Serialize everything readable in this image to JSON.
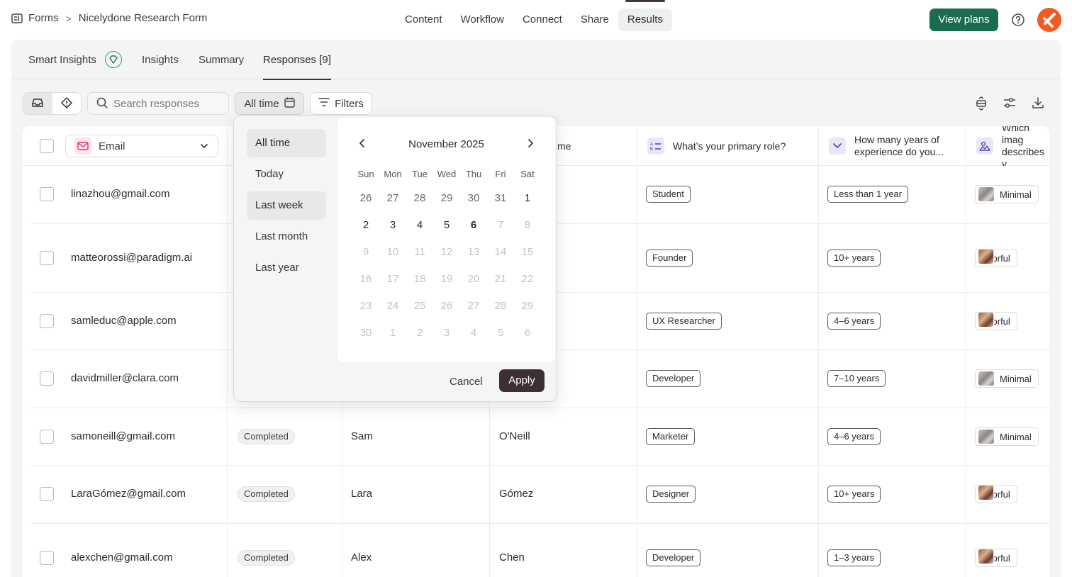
{
  "breadcrumb": {
    "root": "Forms",
    "separator": ">",
    "current": "Nicelydone Research Form"
  },
  "nav": {
    "items": [
      "Content",
      "Workflow",
      "Connect",
      "Share",
      "Results"
    ],
    "active": "Results"
  },
  "header": {
    "cta": "View plans"
  },
  "tabs": [
    {
      "label": "Smart Insights"
    },
    {
      "label": "Insights"
    },
    {
      "label": "Summary"
    },
    {
      "label": "Responses [9]",
      "active": true
    }
  ],
  "toolbar": {
    "search_placeholder": "Search responses",
    "date_button": "All time",
    "filters_button": "Filters"
  },
  "table": {
    "email_column": "Email",
    "headers": {
      "last_name_partial": "me",
      "role": "What’s your primary role?",
      "experience": "How many years of experience do you...",
      "image": "Which imag describes y"
    },
    "rows": [
      {
        "email": "linazhou@gmail.com",
        "status": "",
        "first": "",
        "last": "",
        "role": "Student",
        "experience": "Less than 1 year",
        "style": "Minimal"
      },
      {
        "email": "matteorossi@paradigm.ai",
        "status": "",
        "first": "",
        "last": "",
        "role": "Founder",
        "experience": "10+ years",
        "style": "Colorful"
      },
      {
        "email": "samleduc@apple.com",
        "status": "",
        "first": "",
        "last": "",
        "role": "UX Researcher",
        "experience": "4–6 years",
        "style": "Colorful"
      },
      {
        "email": "davidmiller@clara.com",
        "status": "",
        "first": "",
        "last": "",
        "role": "Developer",
        "experience": "7–10 years",
        "style": "Minimal"
      },
      {
        "email": "samoneill@gmail.com",
        "status": "Completed",
        "first": "Sam",
        "last": "O'Neill",
        "role": "Marketer",
        "experience": "4–6 years",
        "style": "Minimal"
      },
      {
        "email": "LaraGómez@gmail.com",
        "status": "Completed",
        "first": "Lara",
        "last": "Gómez",
        "role": "Designer",
        "experience": "10+ years",
        "style": "Colorful"
      },
      {
        "email": "alexchen@gmail.com",
        "status": "Completed",
        "first": "Alex",
        "last": "Chen",
        "role": "Developer",
        "experience": "1–3 years",
        "style": "Colorful"
      }
    ]
  },
  "date_picker": {
    "presets": [
      "All time",
      "Today",
      "Last week",
      "Last month",
      "Last year"
    ],
    "selected_preset": "All time",
    "highlighted_preset": "Last week",
    "month_label": "November 2025",
    "weekdays": [
      "Sun",
      "Mon",
      "Tue",
      "Wed",
      "Thu",
      "Fri",
      "Sat"
    ],
    "weeks": [
      [
        "26",
        "27",
        "28",
        "29",
        "30",
        "31",
        "1"
      ],
      [
        "2",
        "3",
        "4",
        "5",
        "6",
        "7",
        "8"
      ],
      [
        "9",
        "10",
        "11",
        "12",
        "13",
        "14",
        "15"
      ],
      [
        "16",
        "17",
        "18",
        "19",
        "20",
        "21",
        "22"
      ],
      [
        "23",
        "24",
        "25",
        "26",
        "27",
        "28",
        "29"
      ],
      [
        "30",
        "1",
        "2",
        "3",
        "4",
        "5",
        "6"
      ]
    ],
    "today": "6",
    "cancel": "Cancel",
    "apply": "Apply"
  },
  "colors": {
    "brand": "#1b6b52",
    "apply": "#3d2f35",
    "logo": "#f15a22"
  }
}
